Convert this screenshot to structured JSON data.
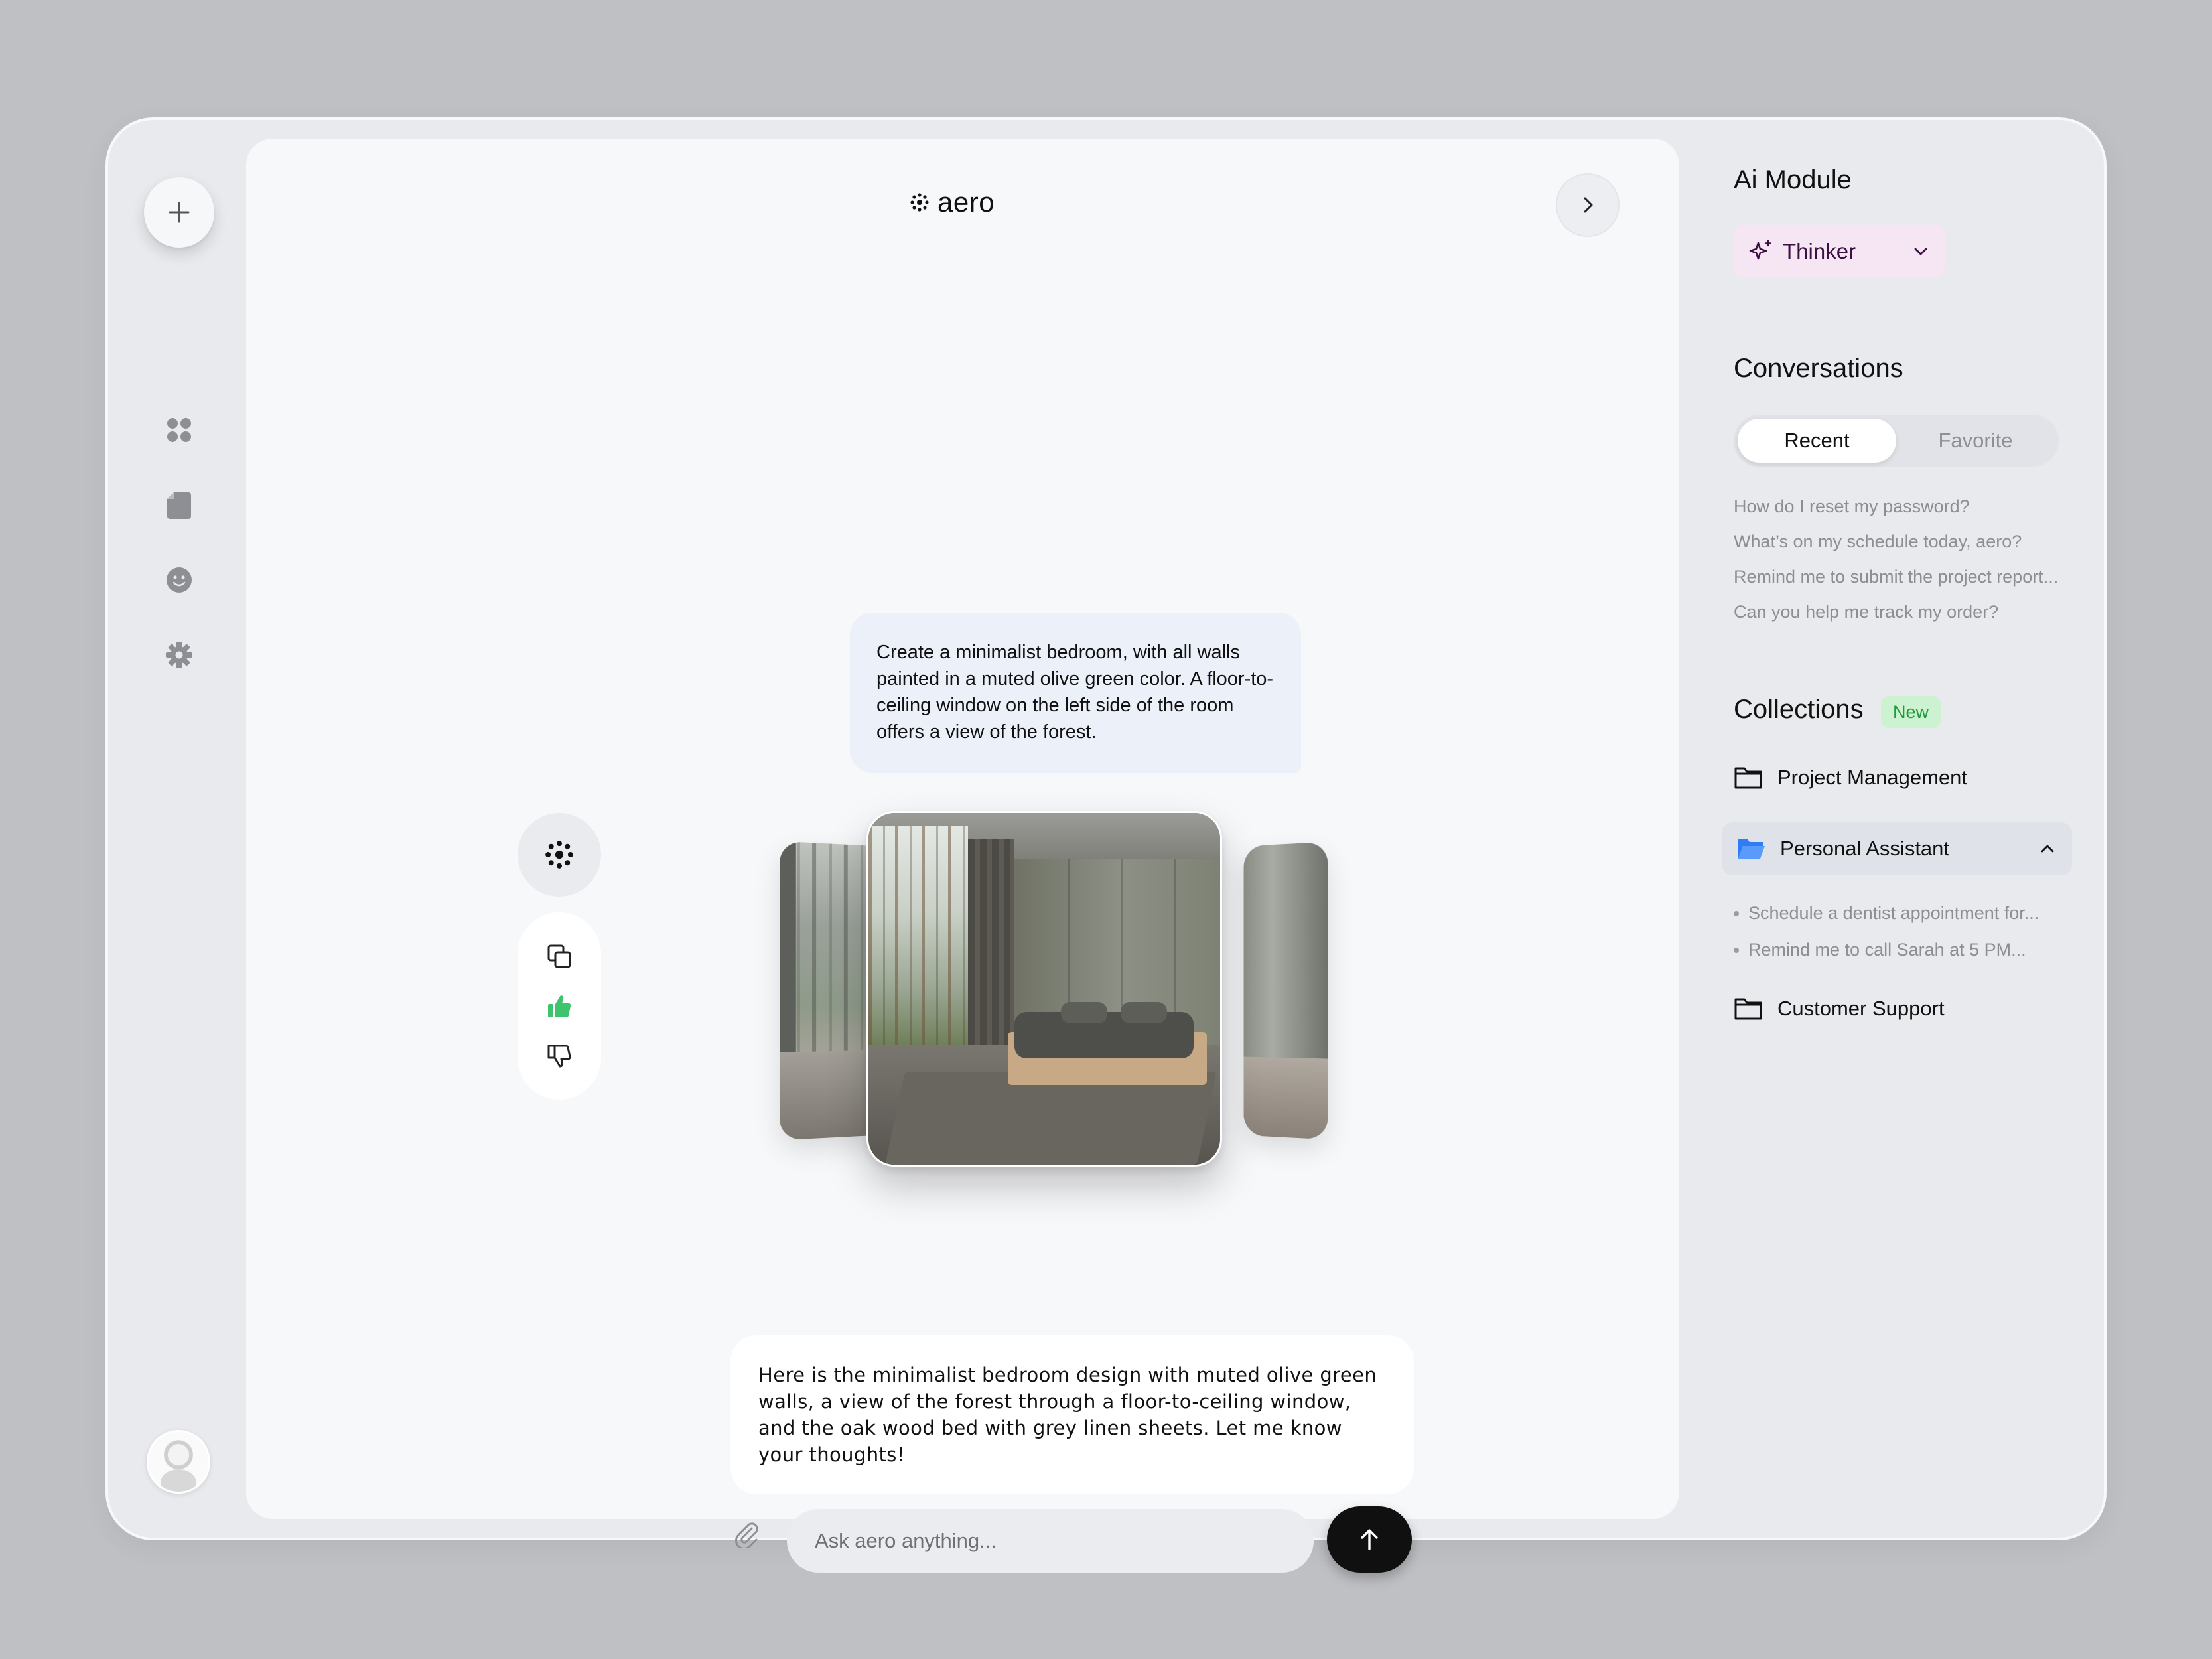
{
  "brand": {
    "name": "aero"
  },
  "chat": {
    "user_message": "Create a minimalist bedroom, with all walls painted in a muted olive green color. A floor-to-ceiling window on the left side of the room offers a view of the forest.",
    "bot_message": "Here is the minimalist bedroom design with muted olive green walls, a view of the forest through a floor-to-ceiling window, and the oak wood bed with grey linen sheets. Let me know your thoughts!",
    "input_placeholder": "Ask aero anything...",
    "input_value": ""
  },
  "sidebar": {
    "icons": [
      "plus-icon",
      "grid-icon",
      "file-icon",
      "smiley-icon",
      "gear-icon"
    ]
  },
  "right_panel": {
    "ai_module_title": "Ai Module",
    "module_selected": "Thinker",
    "conversations_title": "Conversations",
    "tabs": [
      {
        "label": "Recent",
        "active": true
      },
      {
        "label": "Favorite",
        "active": false
      }
    ],
    "conversations": [
      "How do I reset my password?",
      "What’s on my schedule today, aero?",
      "Remind me to submit the project report...",
      "Can you help me track my order?"
    ],
    "collections_title": "Collections",
    "collections_badge": "New",
    "collections": [
      {
        "label": "Project Management"
      },
      {
        "label": "Personal Assistant",
        "open": true,
        "items": [
          "Schedule a dentist appointment for...",
          "Remind me to call Sarah at 5 PM..."
        ]
      },
      {
        "label": "Customer Support"
      }
    ]
  },
  "colors": {
    "accent_green": "#3ec46d",
    "folder_blue": "#2f7cf6",
    "badge_bg": "#cdf2d1",
    "badge_text": "#1f9d3a",
    "module_bg": "#f6e6f4"
  }
}
